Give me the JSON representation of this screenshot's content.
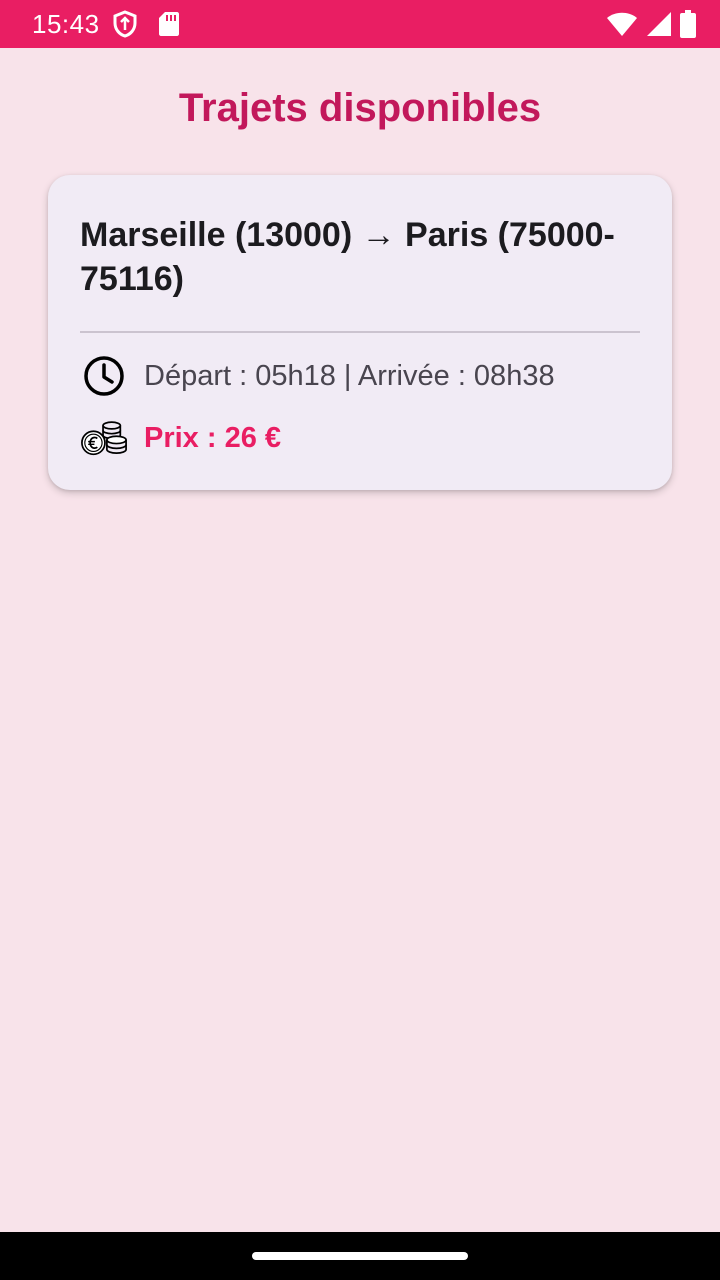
{
  "status_bar": {
    "time": "15:43",
    "left_icons": [
      "shield-icon",
      "sd-card-icon"
    ],
    "right_icons": [
      "wifi-icon",
      "cellular-signal-icon",
      "battery-icon"
    ],
    "color": "#e91e63"
  },
  "page": {
    "title": "Trajets disponibles",
    "background": "#f8e3ea",
    "title_color": "#c2185b"
  },
  "trips": [
    {
      "route": "Marseille (13000) → Paris (75000-75116)",
      "schedule": "Départ : 05h18 | Arrivée : 08h38",
      "schedule_icon": "clock-icon",
      "price": "Prix : 26 €",
      "price_icon": "coins-icon",
      "price_color": "#e91e63"
    }
  ],
  "navigation": {
    "handle": "home-handle"
  }
}
